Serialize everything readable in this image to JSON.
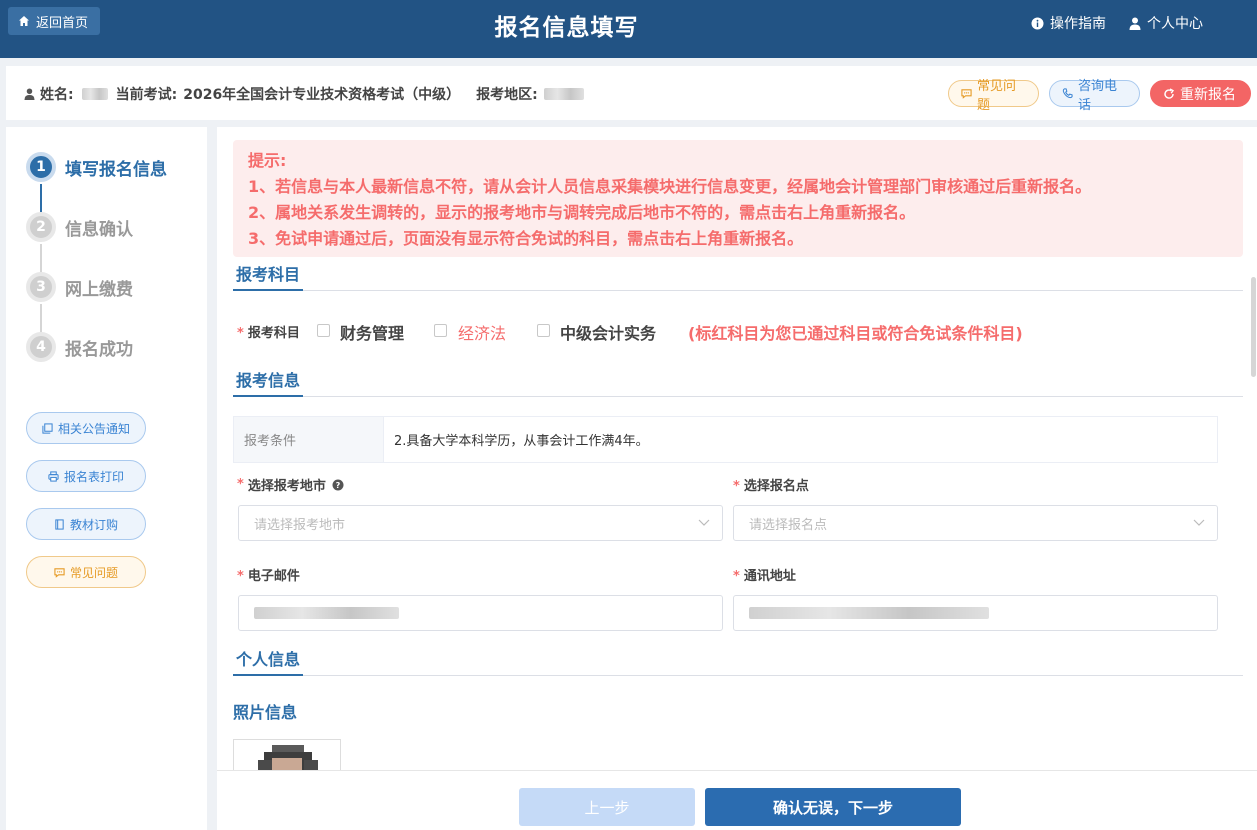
{
  "header": {
    "home_label": "返回首页",
    "title": "报名信息填写",
    "guide_label": "操作指南",
    "user_label": "个人中心"
  },
  "info_bar": {
    "name_label": "姓名:",
    "exam_label": "当前考试:",
    "exam_value": "2026年全国会计专业技术资格考试（中级）",
    "region_label": "报考地区:",
    "faq_label": "常见问题",
    "phone_label": "咨询电话",
    "reapply_label": "重新报名"
  },
  "steps": [
    {
      "num": "1",
      "label": "填写报名信息",
      "active": true
    },
    {
      "num": "2",
      "label": "信息确认",
      "active": false
    },
    {
      "num": "3",
      "label": "网上缴费",
      "active": false
    },
    {
      "num": "4",
      "label": "报名成功",
      "active": false
    }
  ],
  "side_buttons": {
    "notice": "相关公告通知",
    "print": "报名表打印",
    "textbook": "教材订购",
    "faq": "常见问题"
  },
  "alert": {
    "title": "提示:",
    "lines": [
      "1、若信息与本人最新信息不符，请从会计人员信息采集模块进行信息变更，经属地会计管理部门审核通过后重新报名。",
      "2、属地关系发生调转的，显示的报考地市与调转完成后地市不符的，需点击右上角重新报名。",
      "3、免试申请通过后，页面没有显示符合免试的科目，需点击右上角重新报名。"
    ]
  },
  "subjects_section": {
    "title": "报考科目",
    "field_label": "报考科目",
    "options": [
      {
        "label": "财务管理",
        "highlight": false
      },
      {
        "label": "经济法",
        "highlight": true
      },
      {
        "label": "中级会计实务",
        "highlight": false
      }
    ],
    "note": "(标红科目为您已通过科目或符合免试条件科目)"
  },
  "info_section": {
    "title": "报考信息",
    "condition_label": "报考条件",
    "condition_value": "2.具备大学本科学历，从事会计工作满4年。",
    "city_label": "选择报考地市",
    "city_placeholder": "请选择报考地市",
    "site_label": "选择报名点",
    "site_placeholder": "请选择报名点",
    "email_label": "电子邮件",
    "address_label": "通讯地址"
  },
  "personal_section": {
    "title": "个人信息",
    "photo_title": "照片信息"
  },
  "footer": {
    "prev_label": "上一步",
    "next_label": "确认无误，下一步"
  },
  "colors": {
    "header_bg": "#225384",
    "primary": "#2b6cb0",
    "danger": "#f56c6c",
    "warning": "#e69b26"
  },
  "icons": [
    "home-icon",
    "info-icon",
    "user-icon",
    "chat-icon",
    "phone-icon",
    "refresh-icon",
    "copy-icon",
    "printer-icon",
    "book-icon",
    "question-circle-icon",
    "chevron-down-icon"
  ]
}
